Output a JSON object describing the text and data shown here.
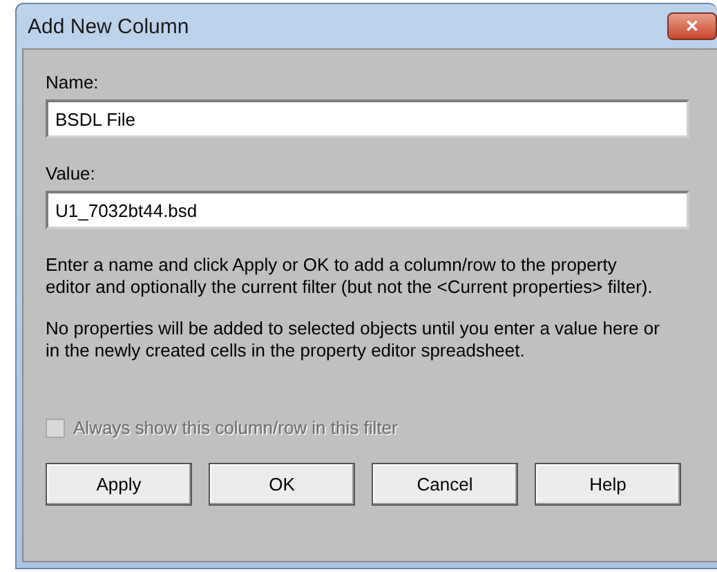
{
  "window": {
    "title": "Add New Column",
    "close_symbol": "✕"
  },
  "fields": [
    {
      "label": "Name:",
      "value": "BSDL File"
    },
    {
      "label": "Value:",
      "value": "U1_7032bt44.bsd"
    }
  ],
  "paragraphs": [
    "Enter a name and click Apply or OK to add a column/row to the property editor and optionally the current filter (but not the <Current properties> filter).",
    "No properties will be added to selected objects until you enter a value here or in the newly created cells in the property editor spreadsheet."
  ],
  "checkbox": {
    "label": "Always show this column/row in this filter",
    "checked": false,
    "disabled": true
  },
  "buttons": [
    "Apply",
    "OK",
    "Cancel",
    "Help"
  ]
}
